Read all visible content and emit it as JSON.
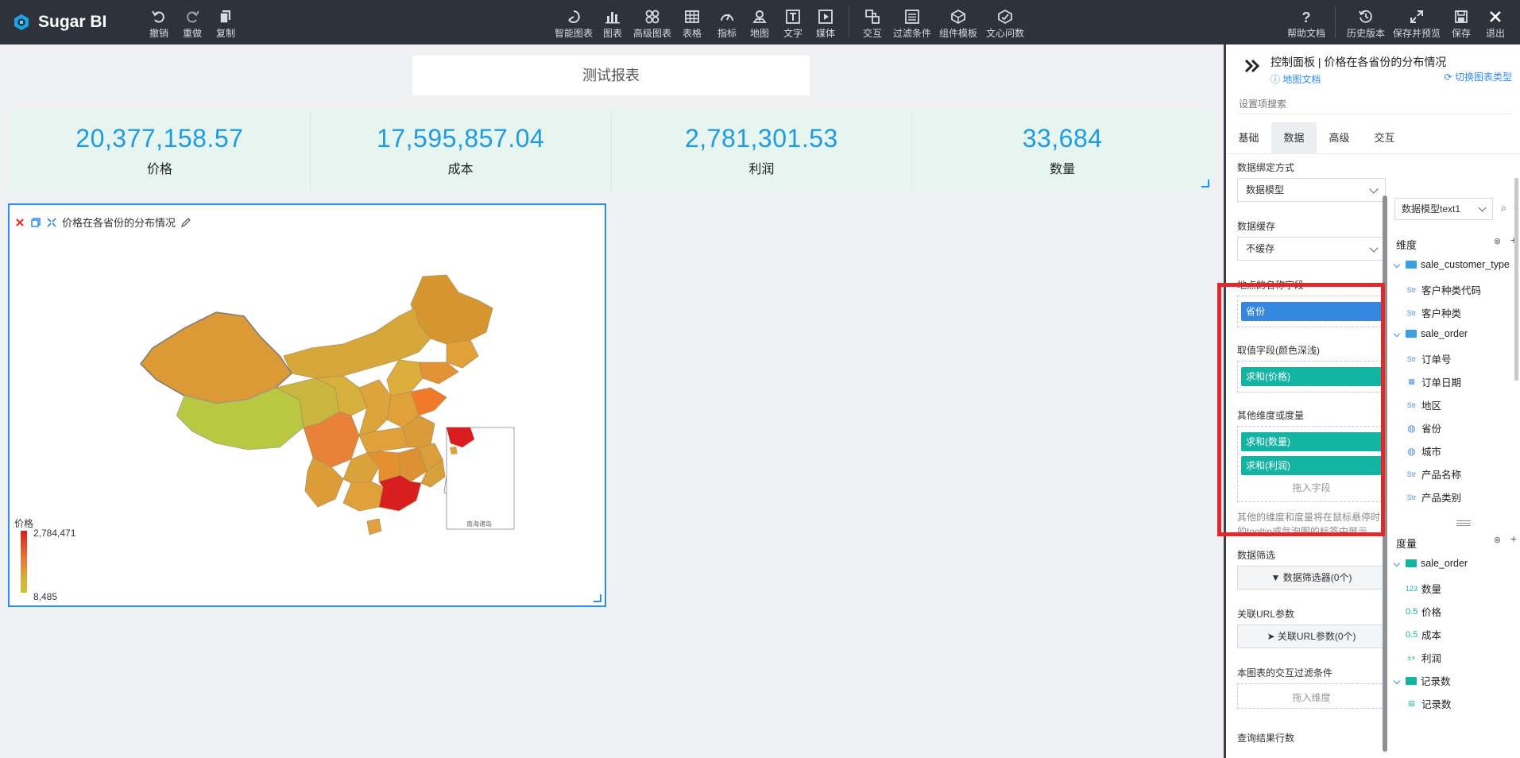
{
  "app": {
    "name": "Sugar BI"
  },
  "toolbar": {
    "left": [
      {
        "label": "撤销",
        "icon": "undo-icon"
      },
      {
        "label": "重做",
        "icon": "redo-icon"
      },
      {
        "label": "复制",
        "icon": "copy-icon"
      }
    ],
    "center": [
      {
        "label": "智能图表",
        "icon": "smart-chart-icon"
      },
      {
        "label": "图表",
        "icon": "bar-chart-icon"
      },
      {
        "label": "高级图表",
        "icon": "advanced-chart-icon"
      },
      {
        "label": "表格",
        "icon": "table-icon"
      },
      {
        "label": "指标",
        "icon": "gauge-icon"
      },
      {
        "label": "地图",
        "icon": "map-pin-icon"
      },
      {
        "label": "文字",
        "icon": "text-icon"
      },
      {
        "label": "媒体",
        "icon": "media-icon"
      },
      {
        "label": "交互",
        "icon": "interaction-icon"
      },
      {
        "label": "过滤条件",
        "icon": "filter-list-icon"
      },
      {
        "label": "组件模板",
        "icon": "component-template-icon"
      },
      {
        "label": "文心问数",
        "icon": "ai-ask-icon"
      }
    ],
    "right": [
      {
        "label": "帮助文档",
        "icon": "help-icon"
      },
      {
        "label": "历史版本",
        "icon": "history-icon"
      },
      {
        "label": "保存并预览",
        "icon": "expand-icon"
      },
      {
        "label": "保存",
        "icon": "save-icon"
      },
      {
        "label": "退出",
        "icon": "close-icon"
      }
    ]
  },
  "report": {
    "title": "测试报表"
  },
  "kpis": [
    {
      "value": "20,377,158.57",
      "name": "价格"
    },
    {
      "value": "17,595,857.04",
      "name": "成本"
    },
    {
      "value": "2,781,301.53",
      "name": "利润"
    },
    {
      "value": "33,684",
      "name": "数量"
    }
  ],
  "map_card": {
    "title": "价格在各省份的分布情况",
    "legend_title": "价格",
    "legend_max": "2,784,471",
    "legend_min": "8,485",
    "inset_label": "南海诸岛",
    "colors": {
      "high": "#d81e1e",
      "mid": "#e8783a",
      "low": "#c8c63e"
    }
  },
  "panel": {
    "title": "控制面板 | 价格在各省份的分布情况",
    "doc_link": "地图文档",
    "switch_link": "切换图表类型",
    "search_placeholder": "设置项搜索",
    "tabs": [
      "基础",
      "数据",
      "高级",
      "交互"
    ],
    "active_tab": "数据",
    "binding": {
      "label": "数据绑定方式",
      "value": "数据模型"
    },
    "cache": {
      "label": "数据缓存",
      "value": "不缓存"
    },
    "location_field": {
      "label": "地点的名称字段",
      "value": "省份"
    },
    "value_field": {
      "label": "取值字段(颜色深浅)",
      "value": "求和(价格)"
    },
    "other_fields": {
      "label": "其他维度或度量",
      "items": [
        "求和(数量)",
        "求和(利润)"
      ],
      "drop_hint": "拖入字段",
      "note": "其他的维度和度量将在鼠标悬停时的tooltip或气泡图的标签中展示"
    },
    "data_filter": {
      "label": "数据筛选",
      "button": "数据筛选器(0个)"
    },
    "url_params": {
      "label": "关联URL参数",
      "button": "关联URL参数(0个)"
    },
    "interaction_filter": {
      "label": "本图表的交互过滤条件",
      "drop_hint": "拖入维度"
    },
    "result_rows": {
      "label": "查询结果行数"
    }
  },
  "fields": {
    "model": "数据模型text1",
    "dimensions_label": "维度",
    "measures_label": "度量",
    "dimension_tree": [
      {
        "kind": "folder",
        "name": "sale_customer_type"
      },
      {
        "kind": "str",
        "tag": "Str",
        "name": "客户种类代码"
      },
      {
        "kind": "str",
        "tag": "Str",
        "name": "客户种类"
      },
      {
        "kind": "folder",
        "name": "sale_order"
      },
      {
        "kind": "str",
        "tag": "Str",
        "name": "订单号"
      },
      {
        "kind": "date",
        "tag": "",
        "name": "订单日期"
      },
      {
        "kind": "str",
        "tag": "Str",
        "name": "地区"
      },
      {
        "kind": "geo",
        "tag": "",
        "name": "省份"
      },
      {
        "kind": "geo",
        "tag": "",
        "name": "城市"
      },
      {
        "kind": "str",
        "tag": "Str",
        "name": "产品名称"
      },
      {
        "kind": "str",
        "tag": "Str",
        "name": "产品类别"
      }
    ],
    "measure_tree": [
      {
        "kind": "folder",
        "name": "sale_order"
      },
      {
        "kind": "int",
        "tag": "123",
        "name": "数量"
      },
      {
        "kind": "float",
        "tag": "0.5",
        "name": "价格"
      },
      {
        "kind": "float",
        "tag": "0.5",
        "name": "成本"
      },
      {
        "kind": "calc",
        "tag": "±×",
        "name": "利润"
      },
      {
        "kind": "folder",
        "name": "记录数"
      },
      {
        "kind": "count",
        "tag": "",
        "name": "记录数"
      }
    ]
  }
}
